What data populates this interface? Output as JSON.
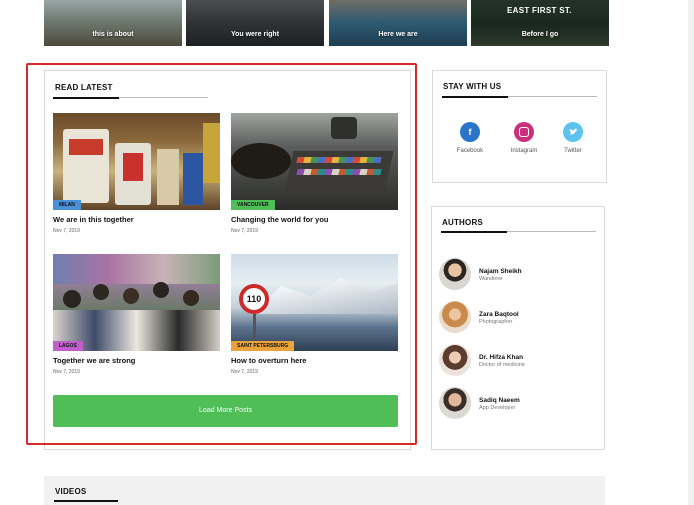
{
  "top_tiles": [
    {
      "caption": "this is about"
    },
    {
      "caption": "You were right"
    },
    {
      "caption": "Here we are"
    },
    {
      "caption": "Before I go",
      "sign": "EAST FIRST ST."
    }
  ],
  "read_latest": {
    "title": "READ LATEST",
    "articles": [
      {
        "tag": "MILAN",
        "tag_color": "#4a90d9",
        "title": "We are in this together",
        "date": "Nov 7, 2019"
      },
      {
        "tag": "VANCOUVER",
        "tag_color": "#4fbe57",
        "title": "Changing the world for you",
        "date": "Nov 7, 2019"
      },
      {
        "tag": "LAGOS",
        "tag_color": "#c15fc9",
        "title": "Together we are strong",
        "date": "Nov 7, 2019"
      },
      {
        "tag": "SAINT PETERSBURG",
        "tag_color": "#e8a33b",
        "title": "How to overturn here",
        "date": "Nov 7, 2019"
      }
    ],
    "load_more": "Load More Posts"
  },
  "stay_with_us": {
    "title": "STAY WITH US",
    "items": [
      {
        "label": "Facebook",
        "icon": "facebook-icon",
        "color": "#2a74c9"
      },
      {
        "label": "Instagram",
        "icon": "instagram-icon",
        "color": "#c9317e"
      },
      {
        "label": "Twitter",
        "icon": "twitter-icon",
        "color": "#5cc3f0"
      }
    ]
  },
  "authors": {
    "title": "AUTHORS",
    "items": [
      {
        "name": "Najam Sheikh",
        "role": "Wanderer"
      },
      {
        "name": "Zara Baqtool",
        "role": "Photographer"
      },
      {
        "name": "Dr. Hifza Khan",
        "role": "Doctor of medicine"
      },
      {
        "name": "Sadiq Naeem",
        "role": "App Developer"
      }
    ]
  },
  "videos": {
    "title": "VIDEOS"
  }
}
